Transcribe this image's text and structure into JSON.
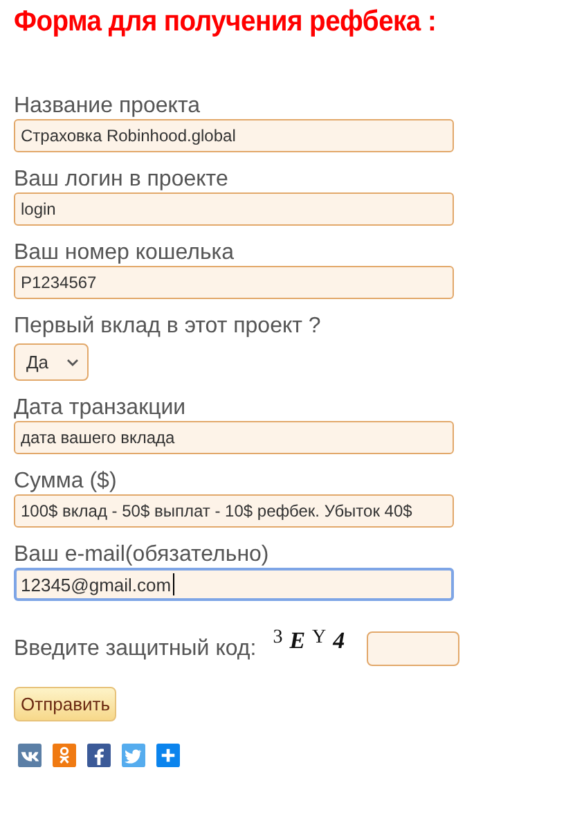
{
  "title": "Форма для получения рефбека :",
  "fields": [
    {
      "kind": "text",
      "label": "Название проекта",
      "value": "Страховка Robinhood.global",
      "focused": false
    },
    {
      "kind": "text",
      "label": "Ваш логин в проекте",
      "value": "login",
      "focused": false
    },
    {
      "kind": "text",
      "label": "Ваш номер кошелька",
      "value": "P1234567",
      "focused": false
    },
    {
      "kind": "select",
      "label": "Первый вклад в этот проект ?",
      "value": "Да",
      "focused": false
    },
    {
      "kind": "text",
      "label": "Дата транзакции",
      "value": "дата вашего вклада",
      "focused": false
    },
    {
      "kind": "text",
      "label": "Сумма ($)",
      "value": "100$ вклад - 50$ выплат - 10$ рефбек. Убыток 40$",
      "focused": false
    },
    {
      "kind": "text",
      "label": "Ваш e-mail(обязательно)",
      "value": "12345@gmail.com",
      "focused": true
    }
  ],
  "captcha": {
    "label": "Введите защитный код:",
    "code": [
      "3",
      "E",
      "Y",
      "4"
    ]
  },
  "submit": "Отправить",
  "share_buttons": [
    {
      "kind": "vk"
    },
    {
      "kind": "ok"
    },
    {
      "kind": "fb"
    },
    {
      "kind": "tw"
    },
    {
      "kind": "plus"
    }
  ]
}
